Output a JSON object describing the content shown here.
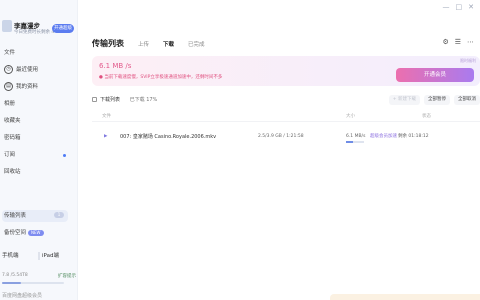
{
  "window": {
    "icons": [
      "—",
      "□",
      "✕"
    ]
  },
  "sidebar": {
    "user": {
      "name": "李嘉漫步",
      "subtitle": "今日免费时长剩余 4",
      "vip_label": "开通超级"
    },
    "items": [
      {
        "label": "文件"
      },
      {
        "label": "最近使用",
        "icon": "clock-icon",
        "glyph": "◷"
      },
      {
        "label": "我的资料",
        "icon": "file-icon",
        "glyph": "▤"
      },
      {
        "label": "相册"
      },
      {
        "label": "收藏夹"
      },
      {
        "label": "密码箱"
      },
      {
        "label": "订阅"
      },
      {
        "label": "回收站"
      }
    ],
    "transfer": {
      "label": "传输列表",
      "badge": "1"
    },
    "backup": {
      "label": "备份空间",
      "tag": "NEW"
    },
    "devices": {
      "phone": "手机端",
      "pad": "iPad端"
    },
    "storage": {
      "used": "7.8 /5.54T8",
      "upgrade": "扩容提示"
    },
    "footer": "百度网盘超级会员"
  },
  "main": {
    "title": "传输列表",
    "tabs": [
      "上传",
      "下载",
      "已完成"
    ],
    "active_tab": "下载",
    "header_icons": [
      "⚙",
      "☰",
      "⋯"
    ],
    "speed": "6.1 MB /s",
    "warning": "● 当前下载速度慢，SVIP立享极速通道加速中，还剩时间不多",
    "corner_label": "限时福利",
    "boost_button": "开通会员",
    "select_all": "下载列表",
    "status_summary": "已下载 17%",
    "tools": [
      "+ 新建下载",
      "全部暂停",
      "全部取消"
    ],
    "columns": [
      "文件",
      "",
      "大小",
      "状态"
    ],
    "rows": [
      {
        "index": "007: 皇家赌场 Casino.Royale.2006.mkv",
        "size": "2.5/3.9 GB / 1:21:58",
        "speed_text": "6.1 MB/s",
        "speed_pill": "超级会员加速",
        "remaining": "剩余 01:18:12",
        "progress": 0.4
      }
    ]
  }
}
